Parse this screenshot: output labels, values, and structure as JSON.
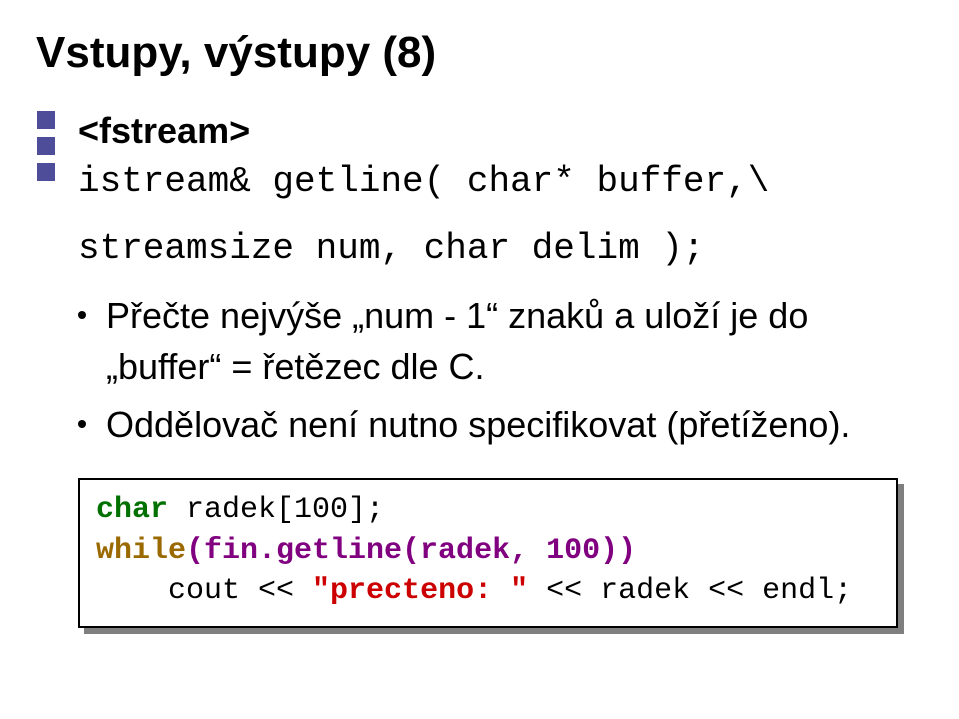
{
  "title": "Vstupy, výstupy (8)",
  "subhead": "<fstream>",
  "decl_line1": "istream& getline( char* buffer,\\",
  "decl_line2": "streamsize num, char delim );",
  "bullets": [
    "Přečte nejvýše „num - 1“ znaků a uloží je do „buffer“ = řetězec dle C.",
    "Oddělovač není nutno specifikovat (přetíženo)."
  ],
  "code": {
    "type_kw": "char",
    "arr_decl": " radek[100];",
    "while_kw": "while",
    "while_open": "(fin.",
    "getline_call": "getline(radek, 100)",
    "while_close": ")",
    "indent": "    ",
    "cout": "cout << ",
    "str": "\"precteno: \"",
    "rest": " << radek << endl;"
  }
}
